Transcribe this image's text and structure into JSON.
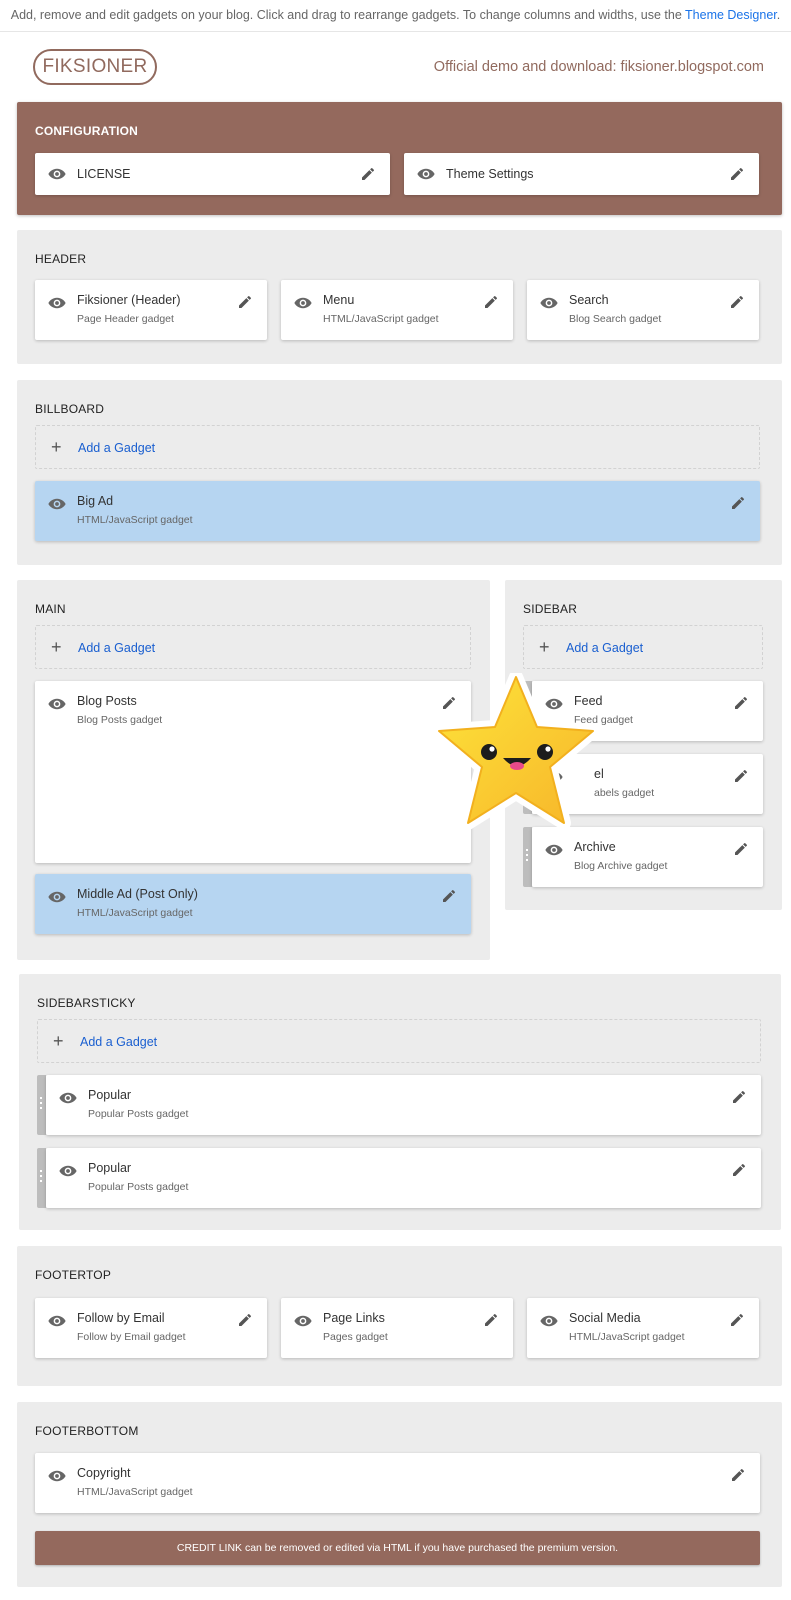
{
  "topbar": {
    "text": "Add, remove and edit gadgets on your blog. Click and drag to rearrange gadgets. To change columns and widths, use the ",
    "link": "Theme Designer",
    "end": "."
  },
  "brand": {
    "logo": "FIKSIONER",
    "demo": "Official demo and download: fiksioner.blogspot.com"
  },
  "sections": {
    "configuration": {
      "title": "CONFIGURATION",
      "gadgets": [
        {
          "name": "LICENSE"
        },
        {
          "name": "Theme Settings"
        }
      ]
    },
    "header": {
      "title": "HEADER",
      "gadgets": [
        {
          "name": "Fiksioner (Header)",
          "type": "Page Header gadget"
        },
        {
          "name": "Menu",
          "type": "HTML/JavaScript gadget"
        },
        {
          "name": "Search",
          "type": "Blog Search gadget"
        }
      ]
    },
    "billboard": {
      "title": "BILLBOARD",
      "add": "Add a Gadget",
      "gadgets": [
        {
          "name": "Big Ad",
          "type": "HTML/JavaScript gadget"
        }
      ]
    },
    "main": {
      "title": "MAIN",
      "add": "Add a Gadget",
      "gadgets": [
        {
          "name": "Blog Posts",
          "type": "Blog Posts gadget"
        },
        {
          "name": "Middle Ad (Post Only)",
          "type": "HTML/JavaScript gadget"
        }
      ]
    },
    "sidebar": {
      "title": "SIDEBAR",
      "add": "Add a Gadget",
      "gadgets": [
        {
          "name": "Feed",
          "type": "Feed gadget"
        },
        {
          "name": "el",
          "type": "abels gadget"
        },
        {
          "name": "Archive",
          "type": "Blog Archive gadget"
        }
      ]
    },
    "sidebarsticky": {
      "title": "SIDEBARSTICKY",
      "add": "Add a Gadget",
      "gadgets": [
        {
          "name": "Popular",
          "type": "Popular Posts gadget"
        },
        {
          "name": "Popular",
          "type": "Popular Posts gadget"
        }
      ]
    },
    "footertop": {
      "title": "FOOTERTOP",
      "gadgets": [
        {
          "name": "Follow by Email",
          "type": "Follow by Email gadget"
        },
        {
          "name": "Page Links",
          "type": "Pages gadget"
        },
        {
          "name": "Social Media",
          "type": "HTML/JavaScript gadget"
        }
      ]
    },
    "footerbottom": {
      "title": "FOOTERBOTTOM",
      "gadgets": [
        {
          "name": "Copyright",
          "type": "HTML/JavaScript gadget"
        }
      ],
      "credit": "CREDIT LINK can be removed or edited via HTML if you have purchased the premium version."
    }
  },
  "colors": {
    "brown": "#94695d",
    "section_bg": "#ececec",
    "highlight": "#b6d5f1",
    "link": "#1a5fd0"
  },
  "icons": {
    "visibility": "eye-icon",
    "edit": "pencil-icon",
    "add": "plus-icon",
    "drag": "drag-handle-icon",
    "mascot": "star-mascot"
  }
}
